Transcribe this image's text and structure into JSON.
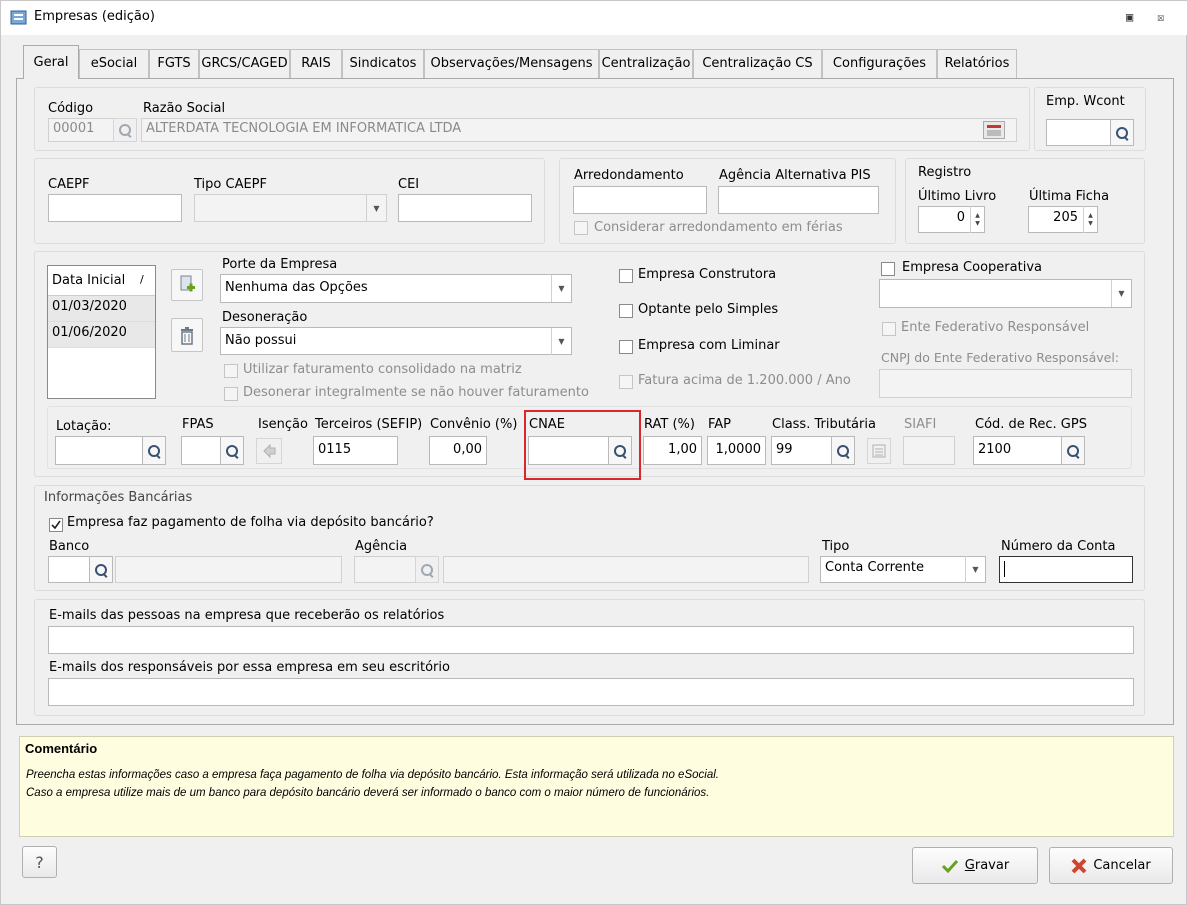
{
  "window": {
    "title": "Empresas (edição)"
  },
  "tabs": [
    "Geral",
    "eSocial",
    "FGTS",
    "GRCS/CAGED",
    "RAIS",
    "Sindicatos",
    "Observações/Mensagens",
    "Centralização",
    "Centralização CS",
    "Configurações",
    "Relatórios"
  ],
  "identificacao": {
    "codigo_label": "Código",
    "codigo_value": "00001",
    "razao_label": "Razão Social",
    "razao_value": "ALTERDATA TECNOLOGIA EM INFORMATICA LTDA",
    "wcont_label": "Emp. Wcont",
    "wcont_value": ""
  },
  "caepf": {
    "caepf_label": "CAEPF",
    "tipo_label": "Tipo CAEPF",
    "cei_label": "CEI"
  },
  "arred": {
    "arred_label": "Arredondamento",
    "agencia_label": "Agência Alternativa PIS",
    "ferias_label": "Considerar arredondamento em férias"
  },
  "registro": {
    "title": "Registro",
    "livro_label": "Último Livro",
    "livro_value": "0",
    "ficha_label": "Última Ficha",
    "ficha_value": "205"
  },
  "datas": {
    "header": "Data Inicial",
    "sort_glyph": "/",
    "rows": [
      "01/03/2020",
      "01/06/2020"
    ]
  },
  "porte": {
    "label": "Porte da Empresa",
    "value": "Nenhuma das Opções"
  },
  "deson": {
    "label": "Desoneração",
    "value": "Não possui",
    "opt1": "Utilizar faturamento consolidado na matriz",
    "opt2": "Desonerar integralmente se não houver faturamento"
  },
  "flags": {
    "construtora": "Empresa Construtora",
    "simples": "Optante pelo Simples",
    "liminar": "Empresa com Liminar",
    "fatura": "Fatura acima de 1.200.000 / Ano",
    "cooperativa": "Empresa Cooperativa",
    "ente": "Ente Federativo Responsável",
    "cnpj_ente": "CNPJ do Ente Federativo Responsável:"
  },
  "fiscal": {
    "lotacao_label": "Lotação:",
    "fpas_label": "FPAS",
    "isencao_label": "Isenção",
    "terceiros_label": "Terceiros (SEFIP)",
    "terceiros_value": "0115",
    "convenio_label": "Convênio (%)",
    "convenio_value": "0,00",
    "cnae_label": "CNAE",
    "rat_label": "RAT (%)",
    "rat_value": "1,00",
    "fap_label": "FAP",
    "fap_value": "1,0000",
    "class_label": "Class. Tributária",
    "class_value": "99",
    "siafi_label": "SIAFI",
    "gps_label": "Cód. de Rec. GPS",
    "gps_value": "2100"
  },
  "banco": {
    "title": "Informações Bancárias",
    "check_label": "Empresa faz pagamento de folha via depósito bancário?",
    "banco_label": "Banco",
    "agencia_label": "Agência",
    "tipo_label": "Tipo",
    "tipo_value": "Conta Corrente",
    "conta_label": "Número da Conta"
  },
  "emails": {
    "empresa_label": "E-mails das pessoas na empresa que receberão os relatórios",
    "escritorio_label": "E-mails dos responsáveis por essa empresa em seu escritório"
  },
  "comment": {
    "title": "Comentário",
    "line1": "Preencha estas informações caso a empresa faça pagamento de folha via depósito bancário. Esta informação será utilizada no eSocial.",
    "line2": "Caso a empresa utilize mais de um banco para depósito bancário deverá ser informado o banco com o maior número de funcionários."
  },
  "footer": {
    "help": "?",
    "gravar_accel": "G",
    "gravar_rest": "ravar",
    "cancelar": "Cancelar"
  },
  "colors": {
    "highlight": "#d9272e",
    "comment_bg": "#fffde0",
    "check_green": "#6aa020",
    "cancel_red": "#d0442c"
  }
}
